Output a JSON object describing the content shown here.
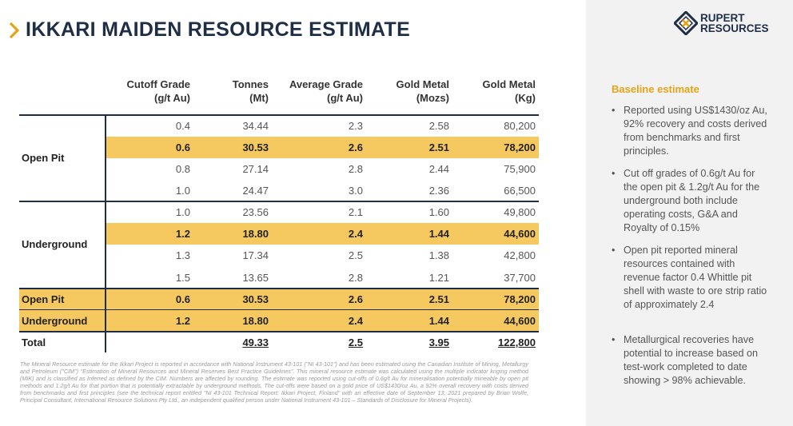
{
  "title": "IKKARI MAIDEN RESOURCE ESTIMATE",
  "logo": {
    "line1": "RUPERT",
    "line2": "RESOURCES"
  },
  "colors": {
    "highlight": "#f5c960",
    "navy": "#1f2e47",
    "orange": "#e8a317"
  },
  "headers": {
    "cutoff": [
      "Cutoff Grade",
      "(g/t Au)"
    ],
    "tonnes": [
      "Tonnes",
      "(Mt)"
    ],
    "grade": [
      "Average Grade",
      "(g/t Au)"
    ],
    "mozs": [
      "Gold Metal",
      "(Mozs)"
    ],
    "kg": [
      "Gold Metal",
      "(Kg)"
    ]
  },
  "groups": {
    "open_pit": "Open Pit",
    "underground": "Underground"
  },
  "rows": [
    [
      "0.4",
      "34.44",
      "2.3",
      "2.58",
      "80,200"
    ],
    [
      "0.6",
      "30.53",
      "2.6",
      "2.51",
      "78,200"
    ],
    [
      "0.8",
      "27.14",
      "2.8",
      "2.44",
      "75,900"
    ],
    [
      "1.0",
      "24.47",
      "3.0",
      "2.36",
      "66,500"
    ],
    [
      "1.0",
      "23.56",
      "2.1",
      "1.60",
      "49,800"
    ],
    [
      "1.2",
      "18.80",
      "2.4",
      "1.44",
      "44,600"
    ],
    [
      "1.3",
      "17.34",
      "2.5",
      "1.38",
      "42,800"
    ],
    [
      "1.5",
      "13.65",
      "2.8",
      "1.21",
      "37,700"
    ]
  ],
  "summary": [
    {
      "label": "Open Pit",
      "values": [
        "0.6",
        "30.53",
        "2.6",
        "2.51",
        "78,200"
      ]
    },
    {
      "label": "Underground",
      "values": [
        "1.2",
        "18.80",
        "2.4",
        "1.44",
        "44,600"
      ]
    },
    {
      "label": "Total",
      "values": [
        "",
        "49.33",
        "2.5",
        "3.95",
        "122,800"
      ]
    }
  ],
  "footnote": "The Mineral Resource estimate for the Ikkari Project is reported in accordance with National Instrument 43-101 (\"NI 43-101\") and has been estimated using the Canadian Institute of Mining, Metallurgy and Petroleum (\"CIM\") \"Estimation of Mineral Resources and Mineral Reserves Best Practice Guidelines\". This mineral resource estimate was calculated using the multiple indicator kriging method (MIK) and is classified as Inferred as defined by the CIM. Numbers are affected by rounding. The estimate was reported using cut-offs of 0.6g/t Au for mineralisation potentially mineable by open pit methods and 1.2g/t Au for that portion that is potentially extractable by underground methods. The cut-offs were based on a gold price of US$1430/oz Au, a 92% overall recovery with costs derived from benchmarks and first principles (see the technical report entitled \"NI 43-101 Technical Report: Ikkari Project, Finland\" with an effective date of September 13, 2021 prepared by Brian Wolfe, Principal Consultant, International Resource Solutions Pty Ltd., an independent qualified person under National Instrument 43-101 – Standards of Disclosure for Mineral Projects).",
  "side": {
    "title": "Baseline estimate",
    "bullets": [
      "Reported using US$1430/oz Au, 92% recovery and costs derived from benchmarks and first principles.",
      "Cut off grades of 0.6g/t Au for the open pit & 1.2g/t Au for the underground both include operating costs, G&A and Royalty of 0.15%",
      "Open pit reported mineral resources contained with revenue factor 0.4 Whittle pit shell with waste to ore strip ratio of approximately 2.4",
      "Metallurgical recoveries have potential to increase based on test-work completed to date showing > 98% achievable."
    ]
  }
}
